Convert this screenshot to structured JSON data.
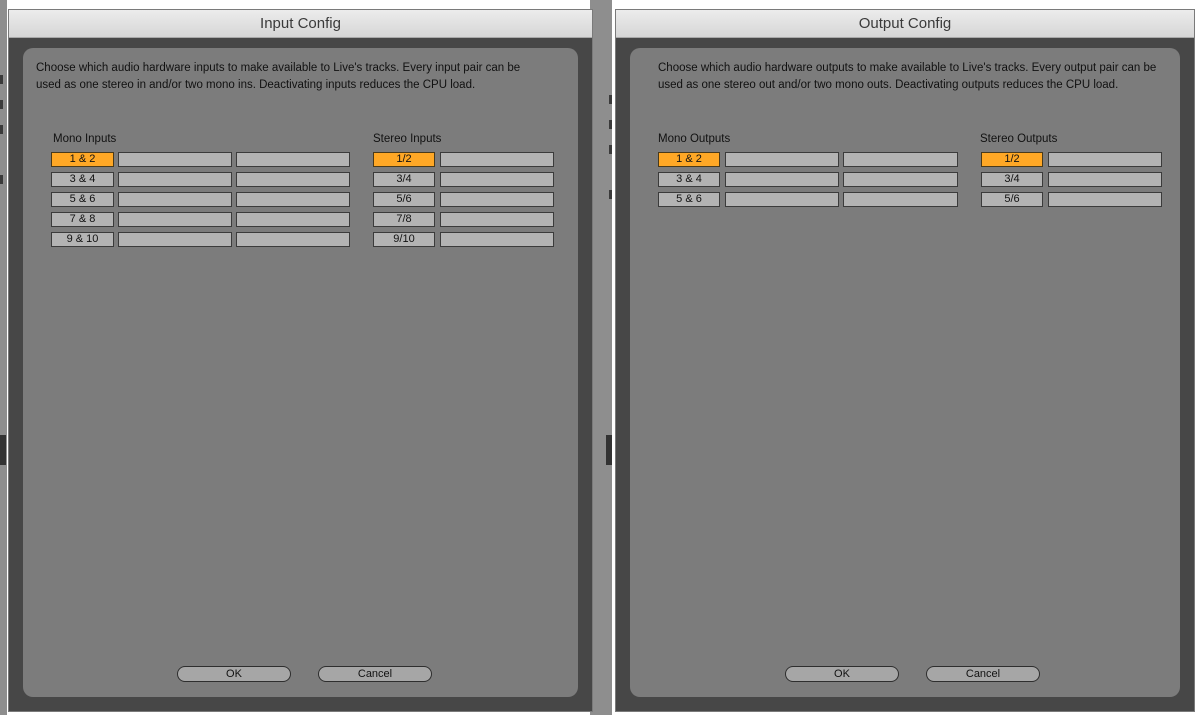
{
  "input_window": {
    "title": "Input Config",
    "description": "Choose which audio hardware inputs to make available to Live's tracks. Every input pair can be used as one stereo in and/or two mono ins.  Deactivating inputs reduces the CPU load.",
    "mono_title": "Mono Inputs",
    "stereo_title": "Stereo Inputs",
    "mono_rows": [
      {
        "label": "1 & 2",
        "active": true
      },
      {
        "label": "3 & 4",
        "active": false
      },
      {
        "label": "5 & 6",
        "active": false
      },
      {
        "label": "7 & 8",
        "active": false
      },
      {
        "label": "9 & 10",
        "active": false
      }
    ],
    "stereo_rows": [
      {
        "label": "1/2",
        "active": true
      },
      {
        "label": "3/4",
        "active": false
      },
      {
        "label": "5/6",
        "active": false
      },
      {
        "label": "7/8",
        "active": false
      },
      {
        "label": "9/10",
        "active": false
      }
    ],
    "ok_label": "OK",
    "cancel_label": "Cancel"
  },
  "output_window": {
    "title": "Output Config",
    "description": "Choose which audio hardware outputs to make available to Live's tracks. Every output pair can be used as one stereo out and/or two mono outs.  Deactivating outputs reduces the CPU load.",
    "mono_title": "Mono Outputs",
    "stereo_title": "Stereo Outputs",
    "mono_rows": [
      {
        "label": "1 & 2",
        "active": true
      },
      {
        "label": "3 & 4",
        "active": false
      },
      {
        "label": "5 & 6",
        "active": false
      }
    ],
    "stereo_rows": [
      {
        "label": "1/2",
        "active": true
      },
      {
        "label": "3/4",
        "active": false
      },
      {
        "label": "5/6",
        "active": false
      }
    ],
    "ok_label": "OK",
    "cancel_label": "Cancel"
  },
  "colors": {
    "active": "#ffa826",
    "inactive": "#b3b3b3",
    "panel": "#7c7c7c",
    "frame": "#474747"
  }
}
